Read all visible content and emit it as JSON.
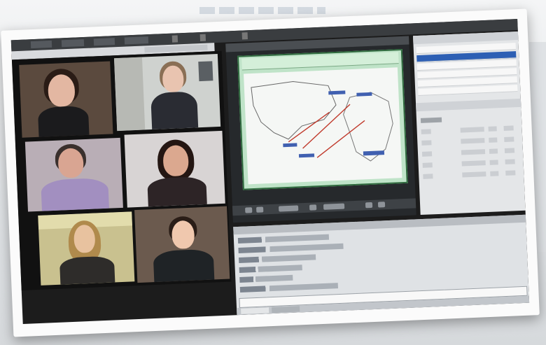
{
  "scene": {
    "description_visible": false,
    "people_count": 6
  },
  "app": {
    "menu": [
      "",
      "",
      "",
      ""
    ],
    "colors": {
      "slide_green": "#bfe3c8",
      "selection_blue": "#2d5fb4",
      "chrome_dark": "#3a3d40"
    }
  }
}
